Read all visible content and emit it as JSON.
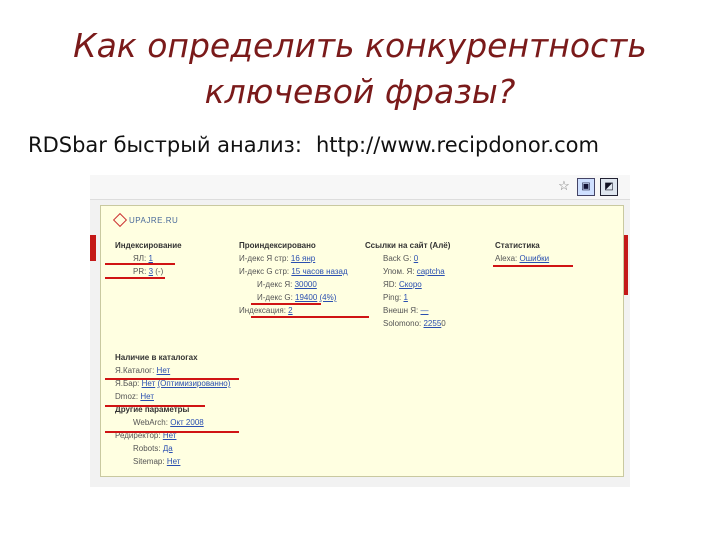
{
  "slide": {
    "title_line1": "Как определить конкурентность",
    "title_line2": "ключевой фразы?",
    "subtitle_label": "RDSbar быстрый анализ:",
    "subtitle_url": "http://www.recipdonor.com"
  },
  "popup": {
    "site": "UPAJRE.RU",
    "indexing": {
      "heading": "Индексирование",
      "rows": [
        {
          "label": "ЯЛ:",
          "value": "1",
          "sep": ""
        },
        {
          "label": "PR:",
          "value": "3",
          "suffix": "(-)"
        }
      ]
    },
    "indexed": {
      "heading": "Проиндексировано",
      "rows": [
        {
          "label": "И-декс Я стр:",
          "value": "16 янр"
        },
        {
          "label": "И-декс G стр:",
          "value": "15 часов назад"
        },
        {
          "label": "И-декс Я:",
          "value": "30000"
        },
        {
          "label": "И-декс G:",
          "value": "19400",
          "suffix": "(4%)"
        },
        {
          "label": "Индексация:",
          "value": "2"
        }
      ]
    },
    "links": {
      "heading": "Ссылки на сайт",
      "heading_link": "(Алё)",
      "rows": [
        {
          "label": "Back G:",
          "value": "0"
        },
        {
          "label": "Упом. Я:",
          "value": "captcha"
        },
        {
          "label": "ЯD:",
          "value": "Скоро"
        },
        {
          "label": "Ping:",
          "value": "1"
        },
        {
          "label": "Внешн Я:",
          "value": "—"
        },
        {
          "label": "Solomono:",
          "value": "2255",
          "suffix": "0"
        }
      ]
    },
    "stats": {
      "heading": "Статистика",
      "rows": [
        {
          "label": "Alexa:",
          "value": "Ошибки"
        }
      ]
    },
    "catalogs": {
      "heading": "Наличие в каталогах",
      "rows": [
        {
          "label": "Я.Каталог:",
          "value": "Нет"
        },
        {
          "label": "Я.Бар:",
          "value": "Нет",
          "suffix": "(Оптимизированно)"
        },
        {
          "label": "Dmoz:",
          "value": "Нет"
        }
      ]
    },
    "other": {
      "heading": "Другие параметры",
      "rows": [
        {
          "label": "WebArch:",
          "value": "Окт 2008"
        },
        {
          "label": "Редиректор:",
          "value": "Нет"
        },
        {
          "label": "Robots:",
          "value": "Да"
        },
        {
          "label": "Sitemap:",
          "value": "Нет"
        }
      ]
    }
  },
  "toolbar": {
    "icons": [
      "star-icon",
      "bookmark-icon",
      "rds-icon"
    ]
  },
  "colors": {
    "title": "#7a1a1a",
    "popup_bg": "#ffffe1",
    "link": "#2a4fb0",
    "underline_mark": "#d01414"
  }
}
